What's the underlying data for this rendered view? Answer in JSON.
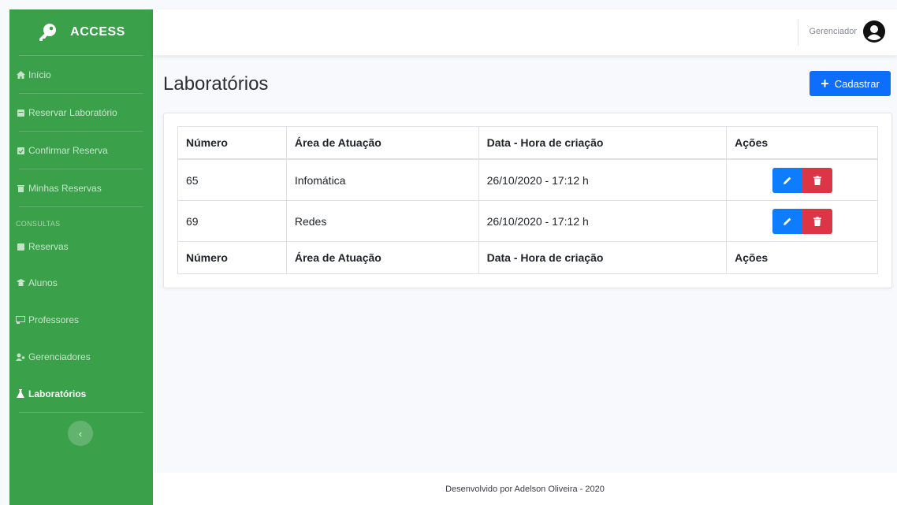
{
  "brand": {
    "name": "ACCESS",
    "icon": "key-icon"
  },
  "sidebar": {
    "items_top": [
      {
        "label": "Início",
        "icon": "home-icon"
      },
      {
        "label": "Reservar Laboratório",
        "icon": "calendar-icon"
      },
      {
        "label": "Confirmar Reserva",
        "icon": "calendar-check-icon"
      },
      {
        "label": "Minhas Reservas",
        "icon": "trash-icon"
      }
    ],
    "section": "CONSULTAS",
    "items_bottom": [
      {
        "label": "Reservas",
        "icon": "calendar-icon"
      },
      {
        "label": "Alunos",
        "icon": "graduation-cap-icon"
      },
      {
        "label": "Professores",
        "icon": "chalkboard-icon"
      },
      {
        "label": "Gerenciadores",
        "icon": "users-icon"
      },
      {
        "label": "Laboratórios",
        "icon": "flask-icon",
        "active": true
      }
    ],
    "toggle_icon": "chevron-left-icon"
  },
  "topbar": {
    "user_label": "Gerenciador",
    "user_icon": "user-circle-icon"
  },
  "page": {
    "title": "Laboratórios",
    "add_button": "Cadastrar"
  },
  "table": {
    "headers": [
      "Número",
      "Área de Atuação",
      "Data - Hora de criação",
      "Ações"
    ],
    "rows": [
      {
        "numero": "65",
        "area": "Infomática",
        "data": "26/10/2020 - 17:12 h"
      },
      {
        "numero": "69",
        "area": "Redes",
        "data": "26/10/2020 - 17:12 h"
      }
    ]
  },
  "footer": {
    "text": "Desenvolvido por Adelson Oliveira - 2020"
  },
  "colors": {
    "sidebar": "#3aa04a",
    "primary": "#0d6efd",
    "danger": "#dc3545"
  }
}
